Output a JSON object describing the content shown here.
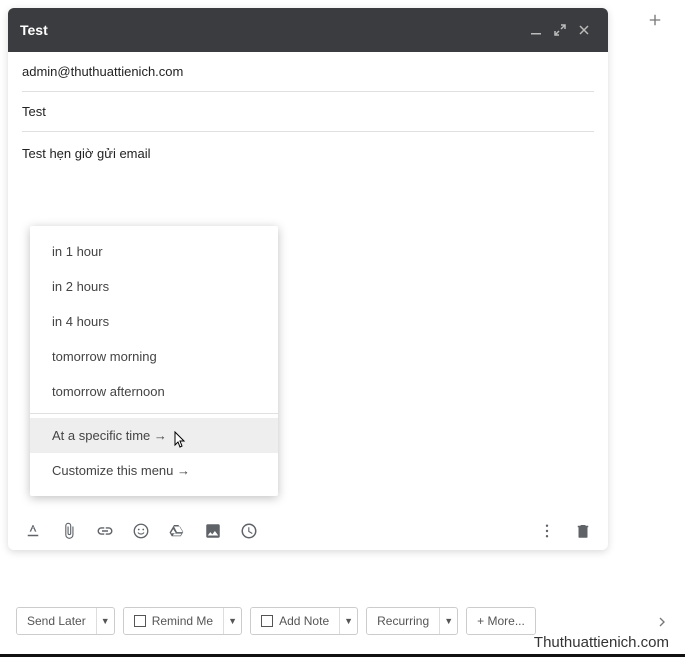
{
  "compose": {
    "title": "Test",
    "to": "admin@thuthuattienich.com",
    "subject": "Test",
    "body": "Test hẹn giờ gửi email"
  },
  "menu": {
    "items_top": [
      "in 1 hour",
      "in 2 hours",
      "in 4 hours",
      "tomorrow morning",
      "tomorrow afternoon"
    ],
    "items_bottom": [
      "At a specific time →",
      "Customize this menu →"
    ],
    "hovered_index": 0
  },
  "bottom_buttons": {
    "send_later": "Send Later",
    "remind_me": "Remind Me",
    "add_note": "Add Note",
    "recurring": "Recurring",
    "more": "+ More..."
  },
  "watermark": "Thuthuattienich.com"
}
